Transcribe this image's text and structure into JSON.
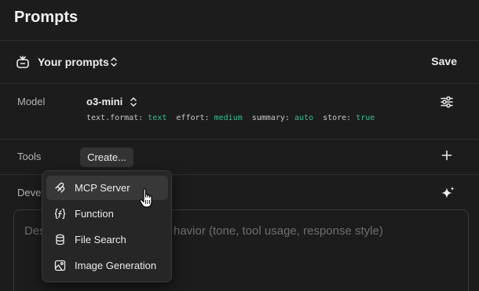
{
  "header": {
    "title": "Prompts"
  },
  "prompts_bar": {
    "label": "Your prompts",
    "save_label": "Save"
  },
  "model_row": {
    "label": "Model",
    "model_name": "o3-mini",
    "params": [
      {
        "key": "text.format:",
        "value": "text"
      },
      {
        "key": "effort:",
        "value": "medium"
      },
      {
        "key": "summary:",
        "value": "auto"
      },
      {
        "key": "store:",
        "value": "true"
      }
    ]
  },
  "tools_row": {
    "label": "Tools",
    "create_label": "Create..."
  },
  "developer_row": {
    "label": "Deve",
    "placeholder_start": "Des",
    "placeholder_end": "havior (tone, tool usage, response style)"
  },
  "create_menu": {
    "items": [
      {
        "label": "MCP Server",
        "icon": "mcp-icon"
      },
      {
        "label": "Function",
        "icon": "function-icon"
      },
      {
        "label": "File Search",
        "icon": "database-icon"
      },
      {
        "label": "Image Generation",
        "icon": "image-icon"
      }
    ]
  },
  "colors": {
    "background": "#1c1c1c",
    "param_value": "#3bbf8f",
    "menu_background": "#262626"
  }
}
